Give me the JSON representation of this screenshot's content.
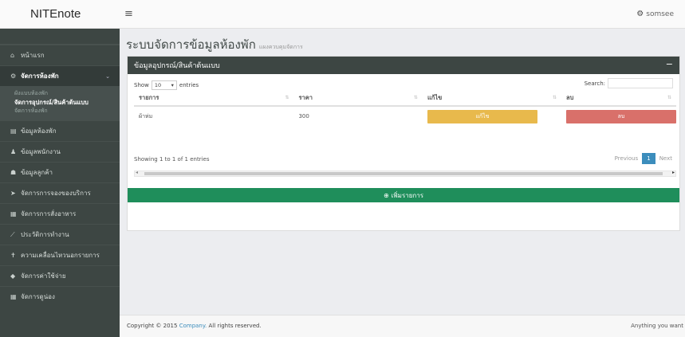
{
  "header": {
    "brand": "NITEnote",
    "menu_icon": "hamburger-icon",
    "user_icon": "gear-icon",
    "username": "somsee"
  },
  "sidebar": {
    "items": [
      {
        "icon": "home-icon",
        "glyph": "⌂",
        "label": "หน้าแรก"
      },
      {
        "icon": "gear-icon",
        "glyph": "⚙",
        "label": "จัดการห้องพัก",
        "active": true
      },
      {
        "icon": "building-icon",
        "glyph": "▤",
        "label": "ข้อมูลห้องพัก"
      },
      {
        "icon": "user-icon",
        "glyph": "♟",
        "label": "ข้อมูลพนักงาน"
      },
      {
        "icon": "group-icon",
        "glyph": "☗",
        "label": "ข้อมูลลูกค้า"
      },
      {
        "icon": "send-icon",
        "glyph": "➤",
        "label": "จัดการการจองของบริการ"
      },
      {
        "icon": "table-icon",
        "glyph": "▦",
        "label": "จัดการการสั่งอาหาร"
      },
      {
        "icon": "chart-icon",
        "glyph": "⟋",
        "label": "ประวัติการทำงาน"
      },
      {
        "icon": "person-icon",
        "glyph": "✝",
        "label": "ความเคลื่อนไหวนอกรายการ"
      },
      {
        "icon": "tag-icon",
        "glyph": "◆",
        "label": "จัดการค่าใช้จ่าย"
      },
      {
        "icon": "grid-icon",
        "glyph": "▦",
        "label": "จัดการดูน่อง"
      }
    ],
    "subitems": [
      {
        "label": "ผังแบบห้องพัก"
      },
      {
        "label": "จัดการอุปกรณ์/สินค้าต้นแบบ",
        "current": true
      },
      {
        "label": "จัดการห้องพัก"
      }
    ]
  },
  "page": {
    "title": "ระบบจัดการข้อมูลห้องพัก",
    "subtitle": "แผงควบคุมจัดการ"
  },
  "panel": {
    "title": "ข้อมูลอุปกรณ์/สินค้าต้นแบบ",
    "collapse": "−",
    "show_label": "Show",
    "show_value": "10",
    "entries_label": "entries",
    "search_label": "Search:",
    "search_value": "",
    "columns": [
      "รายการ",
      "ราคา",
      "แก้ไข",
      "ลบ"
    ],
    "rows": [
      {
        "name": "ผ้าห่ม",
        "price": "300",
        "edit": "แก้ไข",
        "delete": "ลบ"
      }
    ],
    "showing": "Showing 1 to 1 of 1 entries",
    "pagination": {
      "prev": "Previous",
      "current": "1",
      "next": "Next"
    },
    "add_button": "เพิ่มรายการ"
  },
  "footer": {
    "copyright_prefix": "Copyright © 2015",
    "company": "Company.",
    "rights": "All rights reserved.",
    "right_text": "Anything you want"
  },
  "colors": {
    "sidebar": "#3d4643",
    "panel_header": "#3d4643",
    "edit": "#e8b94c",
    "delete": "#d9706a",
    "add": "#1f8e5b",
    "page_active": "#3c8dbc"
  }
}
